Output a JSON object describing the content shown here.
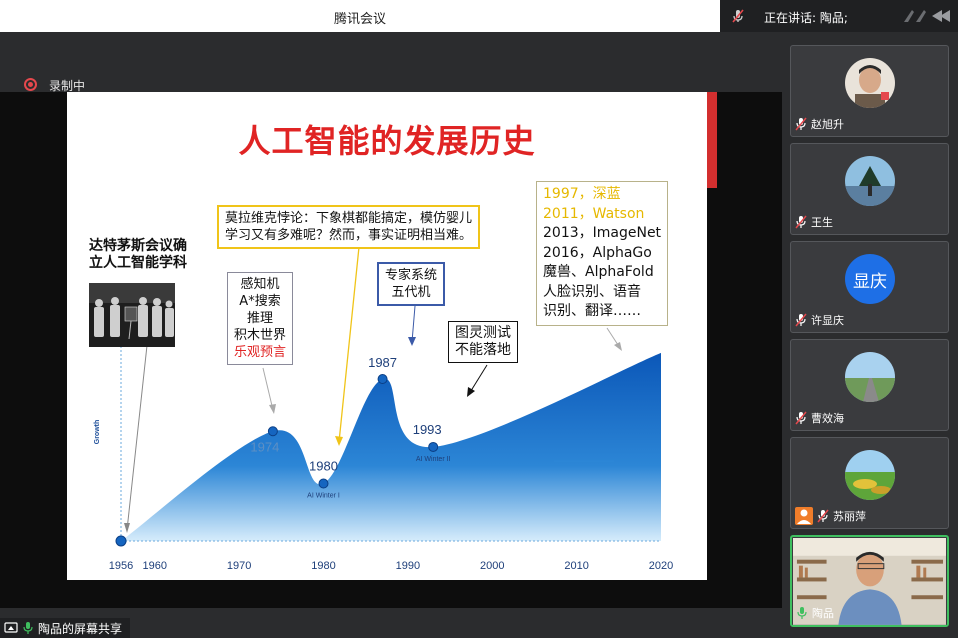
{
  "window": {
    "title": "腾讯会议",
    "speaking_label": "正在讲话: 陶品;"
  },
  "recording": {
    "label": "录制中"
  },
  "share": {
    "label": "陶品的屏幕共享"
  },
  "colors": {
    "accent_green": "#3fbf5f",
    "recording_red": "#e5484d",
    "slide_red": "#e02424",
    "chart_blue": "#1565c0"
  },
  "slide": {
    "title": "人工智能的发展历史",
    "dartmouth": [
      "达特茅斯会议确",
      "立人工智能学科"
    ],
    "box_1974": [
      "感知机",
      "A*搜索",
      "推理",
      "积木世界"
    ],
    "box_1974_red": "乐观预言",
    "moravec": [
      "莫拉维克悖论：下象棋都能搞定，模仿婴儿",
      "学习又有多难呢？然而，事实证明相当难。"
    ],
    "expert": [
      "专家系统",
      "五代机"
    ],
    "turing": [
      "图灵测试",
      "不能落地"
    ],
    "milestones_gold": [
      "1997，深蓝",
      "2011，Watson"
    ],
    "milestones": [
      "2013，ImageNet",
      "2016，AlphaGo",
      "魔兽、AlphaFold",
      "人脸识别、语音",
      "识别、翻译……"
    ],
    "winter1": "AI Winter I",
    "winter2": "AI Winter II"
  },
  "chart_data": {
    "type": "area",
    "title": "",
    "ylabel": "Growth",
    "xlabel": "",
    "x_ticks": [
      "1956",
      "1960",
      "1970",
      "1980",
      "1990",
      "2000",
      "2010",
      "2020"
    ],
    "x": [
      1956,
      1974,
      1980,
      1987,
      1993,
      2020
    ],
    "y": [
      0,
      0.42,
      0.22,
      0.62,
      0.36,
      0.72
    ],
    "point_labels": [
      "",
      "1974",
      "1980",
      "1987",
      "1993",
      ""
    ],
    "xlim": [
      1956,
      2020
    ],
    "grid": false
  },
  "participants": [
    {
      "name": "赵旭升",
      "avatar": "photo-avatar",
      "muted": true
    },
    {
      "name": "王生",
      "avatar": "tree-photo-avatar",
      "muted": true
    },
    {
      "name": "许显庆",
      "avatar_text": "显庆",
      "muted": true
    },
    {
      "name": "曹效海",
      "avatar": "road-photo-avatar",
      "muted": true
    },
    {
      "name": "苏丽萍",
      "avatar": "field-photo-avatar",
      "muted": true
    },
    {
      "name": "陶品",
      "avatar": "video-feed",
      "muted": false,
      "active": true
    }
  ]
}
